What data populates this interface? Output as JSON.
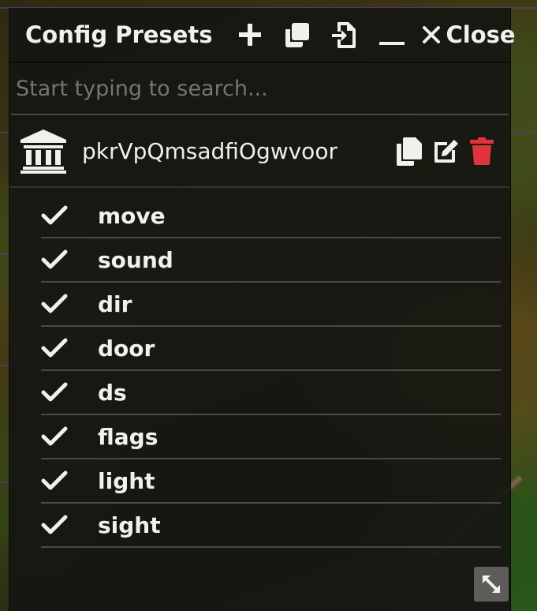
{
  "window": {
    "title": "Config Presets",
    "close_label": "Close"
  },
  "toolbar": {
    "icons": [
      "plus-icon",
      "copy-icon",
      "import-icon",
      "minimize-icon",
      "close-icon"
    ]
  },
  "search": {
    "placeholder": "Start typing to search...",
    "value": ""
  },
  "preset": {
    "name": "pkrVpQmsadfiOgwvoor",
    "icon": "bank-icon",
    "actions": [
      "copy-icon",
      "edit-icon",
      "trash-icon"
    ],
    "delete_color": "#e0343d"
  },
  "options": [
    {
      "label": "move",
      "checked": true
    },
    {
      "label": "sound",
      "checked": true
    },
    {
      "label": "dir",
      "checked": true
    },
    {
      "label": "door",
      "checked": true
    },
    {
      "label": "ds",
      "checked": true
    },
    {
      "label": "flags",
      "checked": true
    },
    {
      "label": "light",
      "checked": true
    },
    {
      "label": "sight",
      "checked": true
    }
  ],
  "colors": {
    "panel_bg": "#161512",
    "text": "#f1f0ea",
    "placeholder": "#77756f",
    "divider": "#4b4944",
    "resize_bg": "#5e5d5a"
  }
}
